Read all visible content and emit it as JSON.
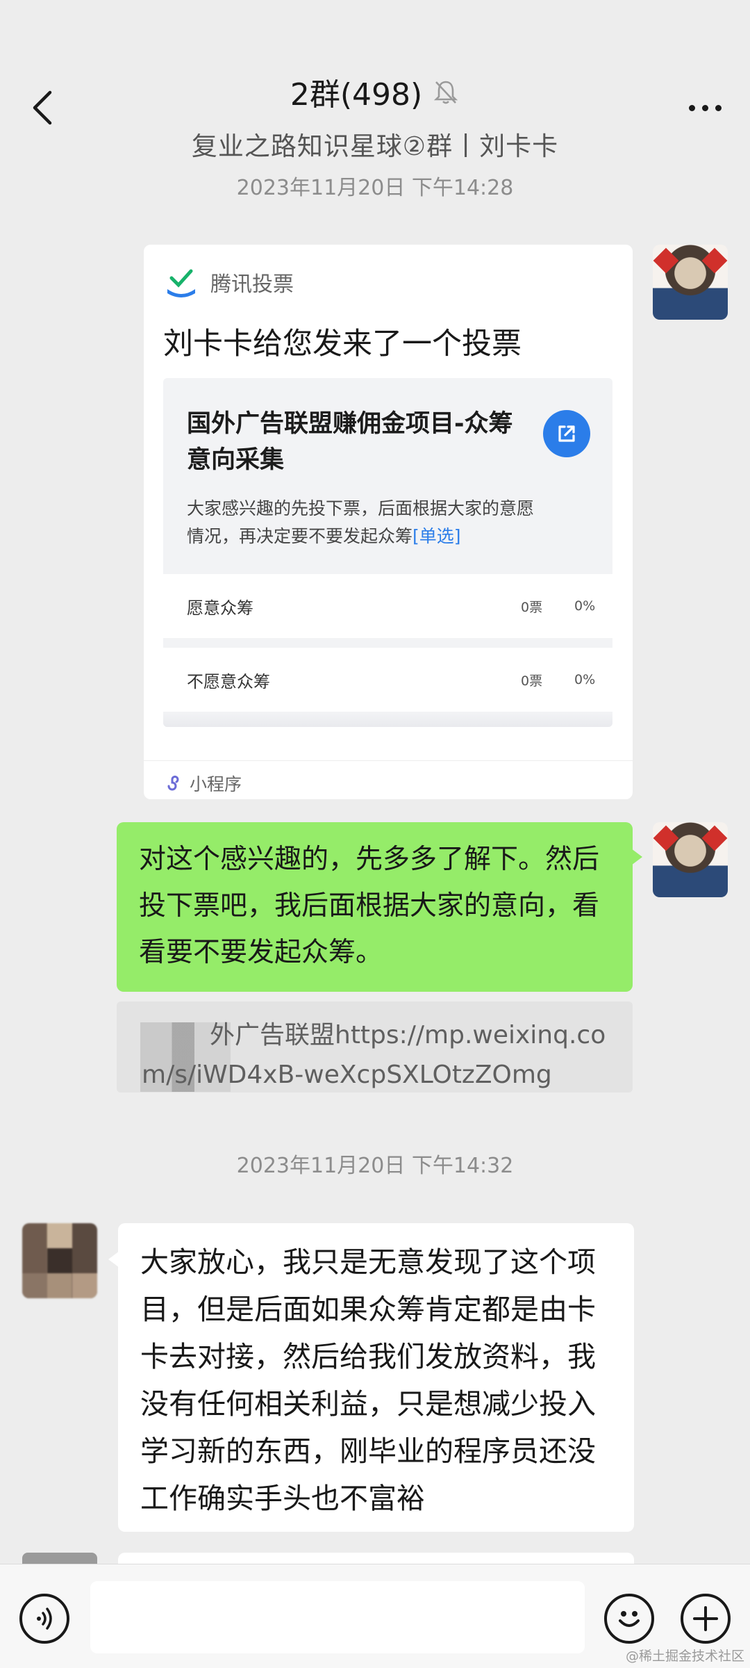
{
  "header": {
    "title": "2群(498)",
    "subtitle": "复业之路知识星球②群丨刘卡卡",
    "icons": {
      "back": "chevron-left-icon",
      "mute": "bell-off-icon",
      "more": "more-dots-icon"
    }
  },
  "timestamps": [
    "2023年11月20日 下午14:28",
    "2023年11月20日 下午14:32"
  ],
  "vote_card": {
    "source": "腾讯投票",
    "title": "刘卡卡给您发来了一个投票",
    "vote_title": "国外广告联盟赚佣金项目-众筹意向采集",
    "vote_desc": "大家感兴趣的先投下票，后面根据大家的意愿情况，再决定要不要发起众筹",
    "vote_type": "[单选]",
    "options": [
      {
        "label": "愿意众筹",
        "count": "0票",
        "pct": "0%"
      },
      {
        "label": "不愿意众筹",
        "count": "0票",
        "pct": "0%"
      }
    ],
    "footer": "小程序"
  },
  "messages": {
    "self_text": "对这个感兴趣的，先多多了解下。然后投下票吧，我后面根据大家的意向，看看要不要发起众筹。",
    "quote_text": "外广告联盟https://mp.weixinq.com/s/iWD4xB-weXcpSXLOtzZOmg",
    "other_text": "大家放心，我只是无意发现了这个项目，但是后面如果众筹肯定都是由卡卡去对接，然后给我们发放资料，我没有任何相关利益，只是想减少投入学习新的东西，刚毕业的程序员还没工作确实手头也不富裕"
  },
  "input_bar": {
    "voice_icon": "voice-icon",
    "emoji_icon": "emoji-icon",
    "plus_icon": "plus-icon",
    "placeholder": ""
  },
  "watermark": "@稀土掘金技术社区",
  "colors": {
    "self_bubble": "#95ec69",
    "link_blue": "#2b7de9",
    "background": "#ededed"
  }
}
